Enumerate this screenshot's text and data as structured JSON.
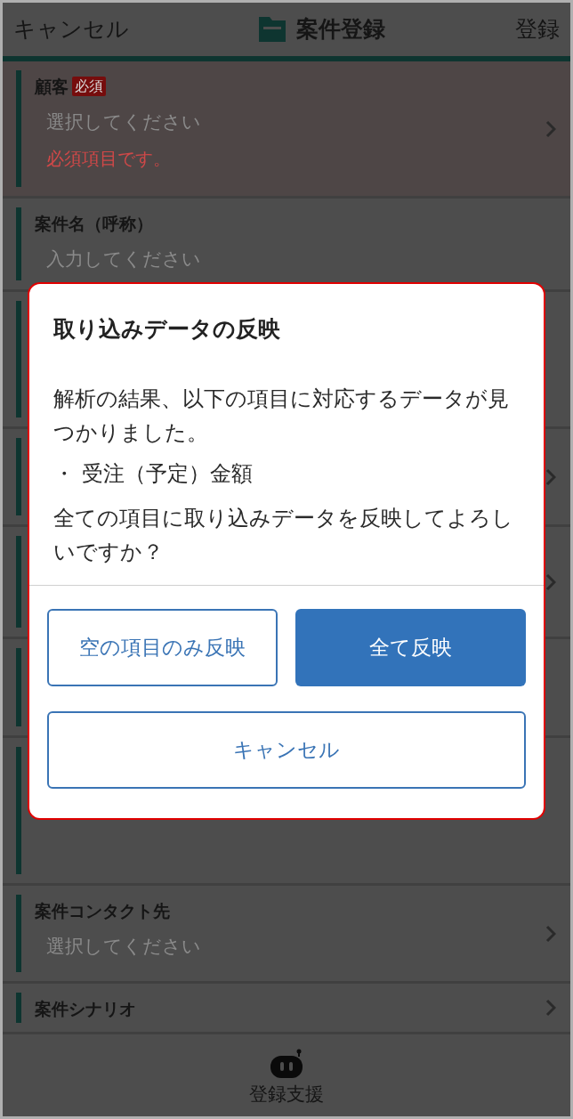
{
  "header": {
    "cancel": "キャンセル",
    "title": "案件登録",
    "submit": "登録"
  },
  "rows": [
    {
      "kind": "select",
      "label": "顧客",
      "badge": "必須",
      "placeholder": "選択してください",
      "error": "必須項目です。"
    },
    {
      "kind": "input",
      "label": "案件名（呼称）",
      "placeholder": "入力してください"
    },
    {
      "kind": "hidden",
      "chevron": false
    },
    {
      "kind": "hidden",
      "chevron": true
    },
    {
      "kind": "hidden",
      "chevron": true
    },
    {
      "kind": "hidden",
      "chevron": false
    },
    {
      "kind": "hidden",
      "chevron": false
    },
    {
      "kind": "select",
      "label": "案件コンタクト先",
      "placeholder": "選択してください"
    },
    {
      "kind": "select",
      "label": "案件シナリオ"
    }
  ],
  "footer": {
    "label": "登録支援"
  },
  "dialog": {
    "title": "取り込みデータの反映",
    "message": "解析の結果、以下の項目に対応するデータが見つかりました。",
    "items": [
      "・ 受注（予定）金額"
    ],
    "question": "全ての項目に取り込みデータを反映してよろしいですか？",
    "buttons": [
      {
        "label": "空の項目のみ反映",
        "kind": "outline"
      },
      {
        "label": "全て反映",
        "kind": "primary"
      },
      {
        "label": "キャンセル",
        "kind": "outline"
      }
    ]
  }
}
